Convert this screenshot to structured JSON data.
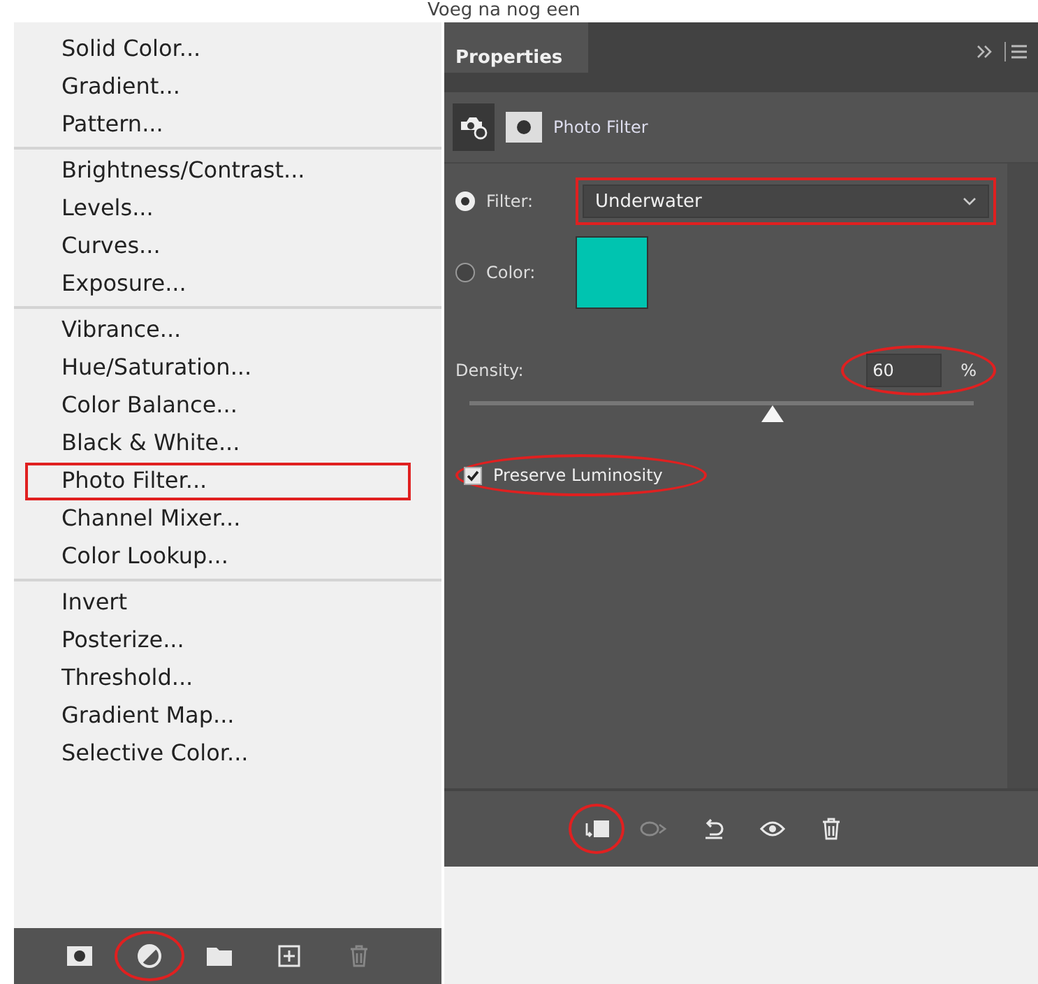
{
  "caption": "Voeg na nog een",
  "menu": {
    "groups": [
      [
        {
          "label": "Solid Color...",
          "highlighted": false
        },
        {
          "label": "Gradient...",
          "highlighted": false
        },
        {
          "label": "Pattern...",
          "highlighted": false
        }
      ],
      [
        {
          "label": "Brightness/Contrast...",
          "highlighted": false
        },
        {
          "label": "Levels...",
          "highlighted": false
        },
        {
          "label": "Curves...",
          "highlighted": false
        },
        {
          "label": "Exposure...",
          "highlighted": false
        }
      ],
      [
        {
          "label": "Vibrance...",
          "highlighted": false
        },
        {
          "label": "Hue/Saturation...",
          "highlighted": false
        },
        {
          "label": "Color Balance...",
          "highlighted": false
        },
        {
          "label": "Black & White...",
          "highlighted": false
        },
        {
          "label": "Photo Filter...",
          "highlighted": true
        },
        {
          "label": "Channel Mixer...",
          "highlighted": false
        },
        {
          "label": "Color Lookup...",
          "highlighted": false
        }
      ],
      [
        {
          "label": "Invert",
          "highlighted": false
        },
        {
          "label": "Posterize...",
          "highlighted": false
        },
        {
          "label": "Threshold...",
          "highlighted": false
        },
        {
          "label": "Gradient Map...",
          "highlighted": false
        },
        {
          "label": "Selective Color...",
          "highlighted": false
        }
      ]
    ]
  },
  "layers_toolbar": [
    {
      "kind": "mask",
      "highlighted": false,
      "disabled": false
    },
    {
      "kind": "adjustment",
      "highlighted": true,
      "disabled": false
    },
    {
      "kind": "folder",
      "highlighted": false,
      "disabled": false
    },
    {
      "kind": "new",
      "highlighted": false,
      "disabled": false
    },
    {
      "kind": "trash",
      "highlighted": false,
      "disabled": true
    }
  ],
  "properties": {
    "tab": "Properties",
    "title": "Photo Filter",
    "filter": {
      "label": "Filter:",
      "selected": true,
      "value": "Underwater",
      "highlighted": true
    },
    "color": {
      "label": "Color:",
      "selected": false,
      "color": "#00c4b0"
    },
    "density": {
      "label": "Density:",
      "value": "60",
      "unit": "%",
      "level": 0.6,
      "highlighted": true
    },
    "preserve": {
      "label": "Preserve Luminosity",
      "checked": true,
      "highlighted": true
    },
    "toolbar": [
      {
        "kind": "clip",
        "highlighted": true,
        "disabled": false
      },
      {
        "kind": "view-previous",
        "highlighted": false,
        "disabled": true
      },
      {
        "kind": "reset",
        "highlighted": false,
        "disabled": false
      },
      {
        "kind": "eye",
        "highlighted": false,
        "disabled": false
      },
      {
        "kind": "trash",
        "highlighted": false,
        "disabled": false
      }
    ]
  }
}
